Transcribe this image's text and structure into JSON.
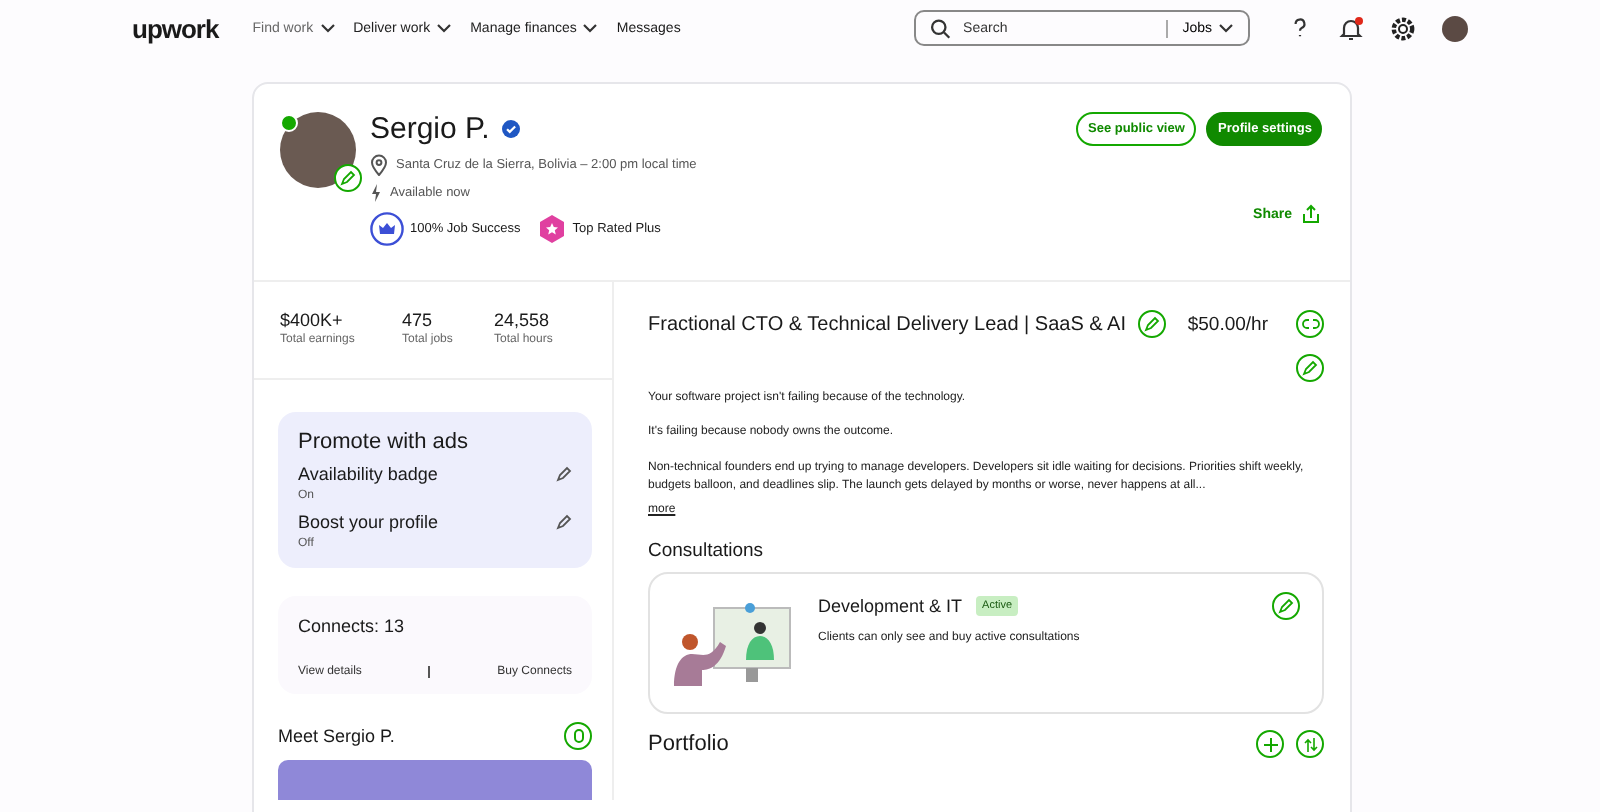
{
  "nav": {
    "logo": "upwork",
    "menus": [
      {
        "label": "Find work"
      },
      {
        "label": "Deliver work"
      },
      {
        "label": "Manage finances"
      }
    ],
    "links": [
      "Messages"
    ],
    "search": {
      "placeholder": "Search",
      "scope": "Jobs"
    },
    "notifications_unread": true
  },
  "profile": {
    "name": "Sergio P.",
    "verified": true,
    "online": true,
    "location": "Santa Cruz de la Sierra, Bolivia – 2:00 pm local time",
    "availability": "Available now",
    "badges": [
      {
        "kind": "success",
        "label": "100% Job Success"
      },
      {
        "kind": "toprated",
        "label": "Top Rated Plus"
      }
    ],
    "buttons": [
      {
        "label": "See public view",
        "kind": "outline"
      },
      {
        "label": "Profile settings",
        "kind": "primary"
      }
    ],
    "share": "Share"
  },
  "stats": [
    {
      "value": "$400K+",
      "label": "Total earnings"
    },
    {
      "value": "475",
      "label": "Total jobs"
    },
    {
      "value": "24,558",
      "label": "Total hours"
    }
  ],
  "promote": {
    "title": "Promote with ads",
    "items": [
      {
        "name": "Availability badge",
        "status": "On"
      },
      {
        "name": "Boost your profile",
        "status": "Off"
      }
    ]
  },
  "connects": {
    "title": "Connects: 13",
    "links": [
      "View details",
      "Buy Connects"
    ]
  },
  "meet": {
    "title": "Meet Sergio P."
  },
  "headline": {
    "title": "Fractional CTO & Technical Delivery Lead | SaaS & AI",
    "rate": "$50.00/hr"
  },
  "overview": {
    "paragraphs": [
      "Your software project isn't failing because of the technology.",
      "It's failing because nobody owns the outcome.",
      "Non-technical founders end up trying to manage developers. Developers sit idle waiting for decisions. Priorities shift weekly, budgets balloon, and deadlines slip. The launch gets delayed by months or worse, never happens at all..."
    ],
    "more": "more"
  },
  "consultations": {
    "title": "Consultations",
    "items": [
      {
        "name": "Development & IT",
        "status": "Active",
        "description": "Clients can only see and buy active consultations"
      }
    ]
  },
  "portfolio": {
    "title": "Portfolio"
  }
}
